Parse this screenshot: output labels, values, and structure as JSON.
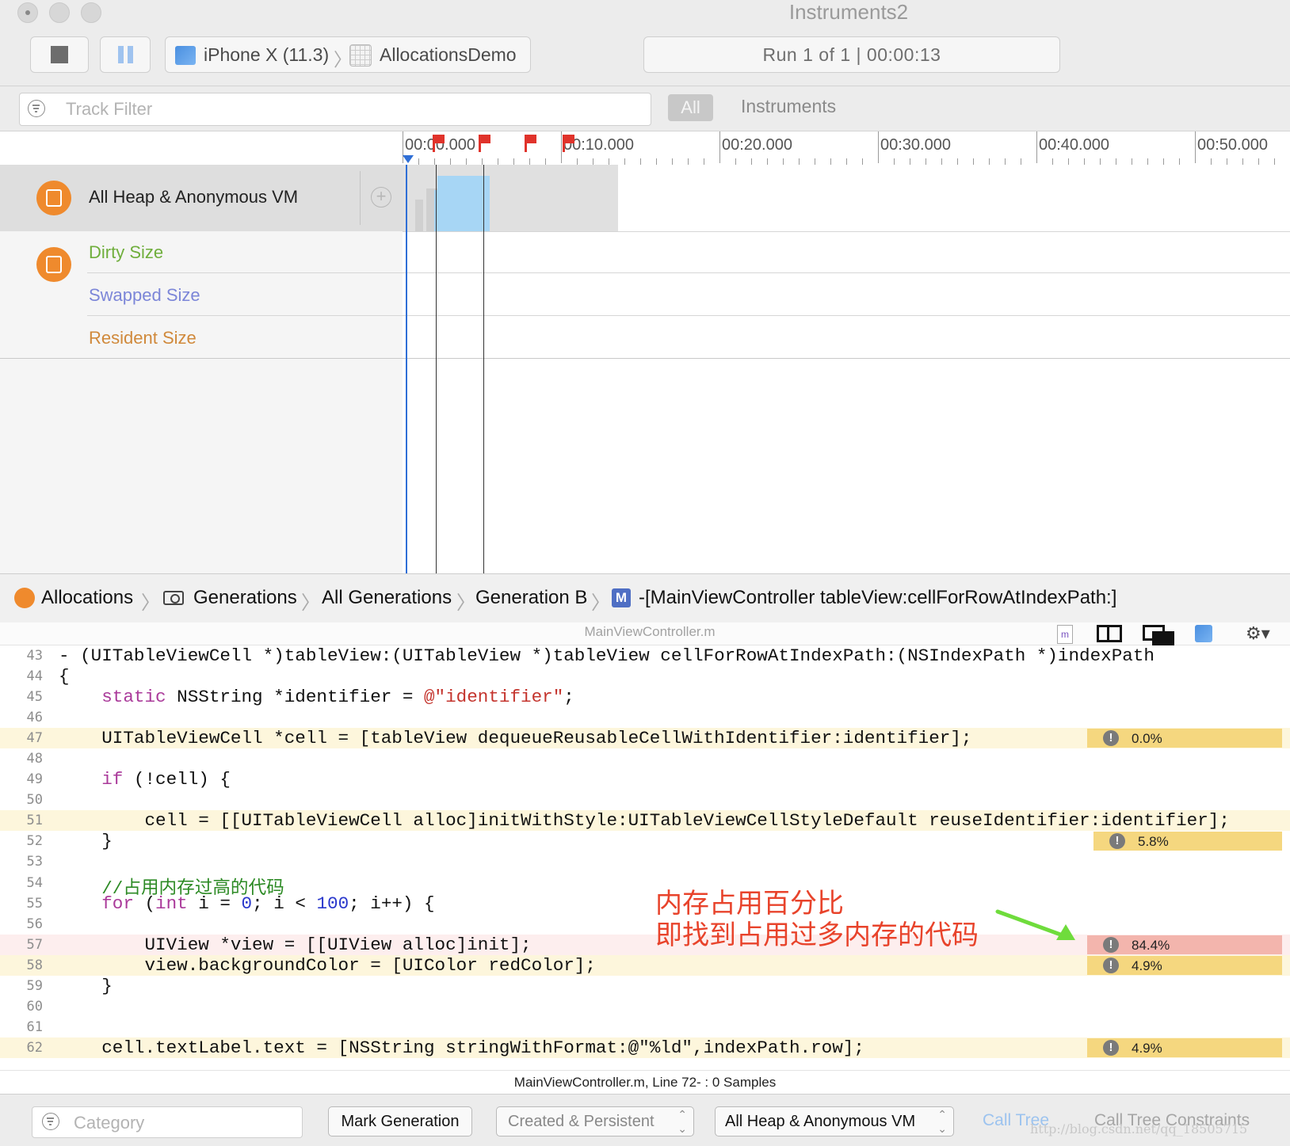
{
  "window": {
    "title": "Instruments2"
  },
  "toolbar": {
    "device": "iPhone X (11.3)",
    "app": "AllocationsDemo",
    "run_status": "Run 1 of 1  |  00:00:13"
  },
  "filterbar": {
    "track_filter_placeholder": "Track Filter",
    "all_label": "All",
    "instruments_label": "Instruments"
  },
  "timeline": {
    "ticks": [
      "00:00.000",
      "00:10.000",
      "00:20.000",
      "00:30.000",
      "00:40.000",
      "00:50.000"
    ]
  },
  "tracks": {
    "instrument_name": "All Heap & Anonymous VM",
    "sub": [
      "Dirty Size",
      "Swapped Size",
      "Resident Size"
    ]
  },
  "jumpbar": {
    "crumbs": [
      "Allocations",
      "Generations",
      "All Generations",
      "Generation B",
      "-[MainViewController tableView:cellForRowAtIndexPath:]"
    ]
  },
  "source": {
    "file": "MainViewController.m",
    "line_numbers": [
      "43",
      "44",
      "45",
      "46",
      "47",
      "48",
      "49",
      "50",
      "51",
      "52",
      "53",
      "54",
      "55",
      "56",
      "57",
      "58",
      "59",
      "60",
      "61",
      "62"
    ],
    "lines": {
      "l43": "- (UITableViewCell *)tableView:(UITableView *)tableView cellForRowAtIndexPath:(NSIndexPath *)indexPath",
      "l44": "{",
      "l45a": "    ",
      "l45b": "static",
      "l45c": " NSString *identifier = ",
      "l45d": "@\"identifier\"",
      "l45e": ";",
      "l47": "    UITableViewCell *cell = [tableView dequeueReusableCellWithIdentifier:identifier];",
      "l49a": "    ",
      "l49b": "if",
      "l49c": " (!cell) {",
      "l51": "        cell = [[UITableViewCell alloc]initWithStyle:UITableViewCellStyleDefault reuseIdentifier:identifier];",
      "l52": "    }",
      "l54": "    //占用内存过高的代码",
      "l55a": "    ",
      "l55b": "for",
      "l55c": " (",
      "l55d": "int",
      "l55e": " i = ",
      "l55f": "0",
      "l55g": "; i < ",
      "l55h": "100",
      "l55i": "; i++) {",
      "l57": "        UIView *view = [[UIView alloc]init];",
      "l58": "        view.backgroundColor = [UIColor redColor];",
      "l59": "    }",
      "l62": "    cell.textLabel.text = [NSString stringWithFormat:@\"%ld\",indexPath.row];"
    },
    "percentages": {
      "l47": "0.0%",
      "l52": "5.8%",
      "l57": "84.4%",
      "l58": "4.9%",
      "l62": "4.9%"
    },
    "annotation_line1": "内存占用百分比",
    "annotation_line2": "即找到占用过多内存的代码"
  },
  "status": {
    "text": "MainViewController.m, Line 72- : 0 Samples"
  },
  "bottombar": {
    "category_placeholder": "Category",
    "mark_generation": "Mark Generation",
    "created_persistent": "Created & Persistent",
    "heap_selector": "All Heap & Anonymous VM",
    "call_tree": "Call Tree",
    "call_tree_constraints": "Call Tree Constraints",
    "watermark": "http://blog.csdn.net/qq_18505715"
  },
  "colors": {
    "accent_orange": "#ef8a2d",
    "dirty_size": "#6fae3c",
    "swapped_size": "#7c86d8",
    "resident_size": "#d0893b",
    "heap_graph_fill": "#a7d6f5",
    "highlight_yellow": "#f5d77f",
    "highlight_red": "#f3b5ad",
    "annotation_red": "#e8432b",
    "arrow_green": "#6fdc3c"
  }
}
